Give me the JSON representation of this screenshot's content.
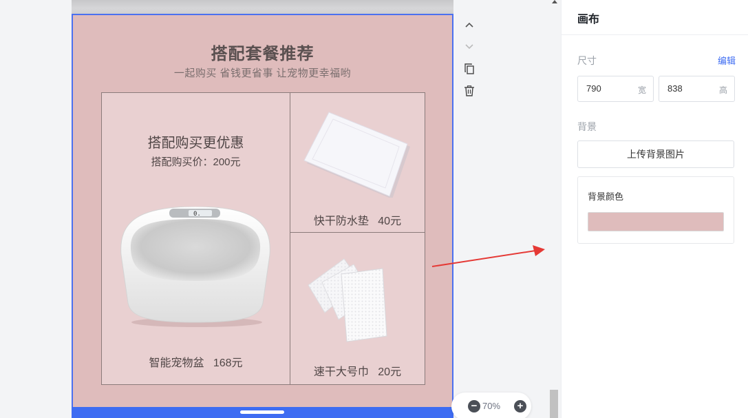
{
  "poster": {
    "title": "搭配套餐推荐",
    "subtitle": "一起购买 省钱更省事 让宠物更幸福哟",
    "background_color": "#dfbcbc",
    "main": {
      "heading": "搭配购买更优惠",
      "price": "搭配购买价：200元",
      "product": "智能宠物盆",
      "product_price": "168元",
      "display_digits": "0."
    },
    "item_top": {
      "product": "快干防水垫",
      "price": "40元"
    },
    "item_bottom": {
      "product": "速干大号巾",
      "price": "20元"
    }
  },
  "toolbar": {
    "icons": [
      "chevron-up-icon",
      "chevron-down-icon",
      "copy-icon",
      "trash-icon"
    ]
  },
  "zoom": {
    "value": "70%",
    "minus": "−",
    "plus": "+"
  },
  "panel": {
    "title": "画布",
    "size_label": "尺寸",
    "edit_label": "编辑",
    "width_value": "790",
    "width_unit": "宽",
    "height_value": "838",
    "height_unit": "高",
    "background_label": "背景",
    "upload_label": "上传背景图片",
    "bg_color_label": "背景颜色",
    "bg_color": "#dfbcbc"
  },
  "colors": {
    "accent": "#3e6cf2",
    "arrow": "#e53935"
  }
}
